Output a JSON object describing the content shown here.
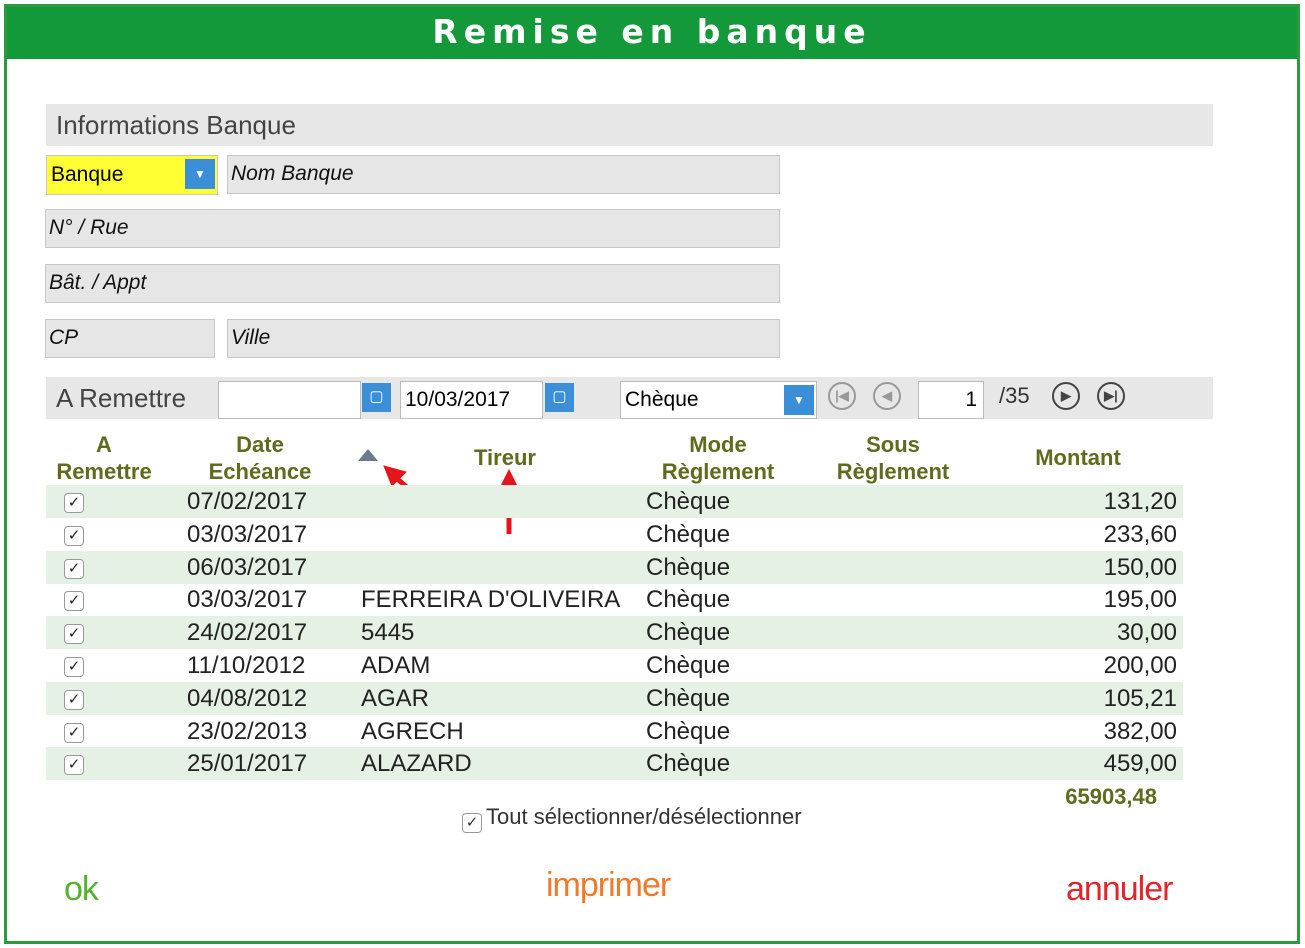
{
  "window": {
    "title": "Remise en banque"
  },
  "bank_info": {
    "section_label": "Informations Banque",
    "bank_select": "Banque",
    "bank_name": "Nom Banque",
    "street": "N° / Rue",
    "building": "Bât. / Appt",
    "postal_code": "CP",
    "city": "Ville"
  },
  "remit_bar": {
    "label": "A Remettre",
    "date_from": "",
    "date_to": "10/03/2017",
    "mode_select": "Chèque",
    "page_current": "1",
    "page_total": "/35"
  },
  "table": {
    "headers": {
      "a_remettre": [
        "A",
        "Remettre"
      ],
      "date": [
        "Date",
        "Echéance"
      ],
      "tireur": "Tireur",
      "mode": [
        "Mode",
        "Règlement"
      ],
      "sous": [
        "Sous",
        "Règlement"
      ],
      "montant": "Montant"
    },
    "rows": [
      {
        "checked": true,
        "date": "07/02/2017",
        "tireur": "",
        "mode": "Chèque",
        "amount": "131,20"
      },
      {
        "checked": true,
        "date": "03/03/2017",
        "tireur": "",
        "mode": "Chèque",
        "amount": "233,60"
      },
      {
        "checked": true,
        "date": "06/03/2017",
        "tireur": "",
        "mode": "Chèque",
        "amount": "150,00"
      },
      {
        "checked": true,
        "date": "03/03/2017",
        "tireur": "FERREIRA D'OLIVEIRA",
        "mode": "Chèque",
        "amount": "195,00"
      },
      {
        "checked": true,
        "date": "24/02/2017",
        "tireur": "5445",
        "mode": "Chèque",
        "amount": "30,00"
      },
      {
        "checked": true,
        "date": "11/10/2012",
        "tireur": "ADAM",
        "mode": "Chèque",
        "amount": "200,00"
      },
      {
        "checked": true,
        "date": "04/08/2012",
        "tireur": "AGAR",
        "mode": "Chèque",
        "amount": "105,21"
      },
      {
        "checked": true,
        "date": "23/02/2013",
        "tireur": "AGRECH",
        "mode": "Chèque",
        "amount": "382,00"
      },
      {
        "checked": true,
        "date": "25/01/2017",
        "tireur": "ALAZARD",
        "mode": "Chèque",
        "amount": "459,00"
      }
    ],
    "total": "65903,48",
    "select_all_label": "Tout sélectionner/désélectionner"
  },
  "actions": {
    "ok": "ok",
    "print": "imprimer",
    "cancel": "annuler"
  },
  "colors": {
    "title_bg": "#14993a",
    "header_text": "#616a1d",
    "row_alt": "#e6f1e5",
    "ok": "#55b32f",
    "print": "#f07a2a",
    "cancel": "#e0262b",
    "annotation_arrow": "#e8141b"
  }
}
